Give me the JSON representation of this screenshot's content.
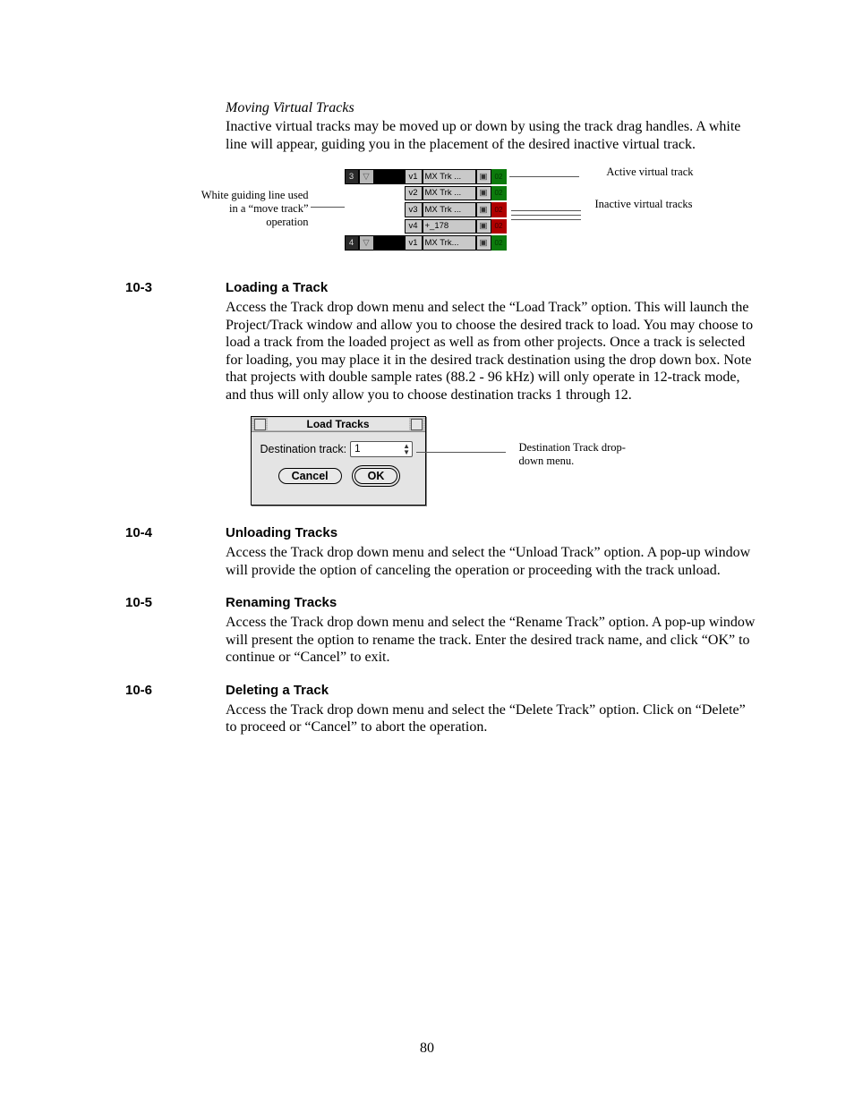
{
  "page_number": "80",
  "sec0": {
    "title": "Moving Virtual Tracks",
    "body": "Inactive virtual tracks may be moved up or down by using the track drag handles. A white line will appear, guiding you in the placement of the desired inactive virtual track."
  },
  "fig1": {
    "note_left": "White guiding line used in a “move track” operation",
    "note_right_active": "Active virtual track",
    "note_right_inactive": "Inactive virtual tracks",
    "rows": [
      {
        "num": "3",
        "v": "v1",
        "name": "MX Trk ...",
        "end": "green"
      },
      {
        "num": "",
        "v": "v2",
        "name": "MX Trk ...",
        "end": "green"
      },
      {
        "num": "",
        "v": "v3",
        "name": "MX Trk ...",
        "end": "red"
      },
      {
        "num": "",
        "v": "v4",
        "name": "+_178",
        "end": "red"
      },
      {
        "num": "4",
        "v": "v1",
        "name": "MX Trk...",
        "end": "green"
      }
    ],
    "end_badge": "02"
  },
  "sec3": {
    "num": "10-3",
    "title": "Loading a Track",
    "body": "Access the Track drop down menu and select the “Load Track” option. This will launch the Project/Track window and allow you to choose the desired track to load. You may choose to load a track from the loaded project as well as from other projects. Once a track is selected for loading, you may place it in the desired track destination using the drop down box. Note that projects with double sample rates (88.2 - 96 kHz) will only operate in 12-track mode, and thus will only allow you to choose destination tracks 1 through 12."
  },
  "fig2": {
    "dialog_title": "Load Tracks",
    "field_label": "Destination track:",
    "field_value": "1",
    "cancel": "Cancel",
    "ok": "OK",
    "note": "Destination Track drop-down menu."
  },
  "sec4": {
    "num": "10-4",
    "title": "Unloading Tracks",
    "body": "Access the Track drop down menu and select the “Unload Track” option. A pop-up window will provide the option of canceling the operation or proceeding with the track unload."
  },
  "sec5": {
    "num": "10-5",
    "title": "Renaming Tracks",
    "body": "Access the Track drop down menu and select the “Rename Track” option. A pop-up window will present the option to rename the track.  Enter the desired track name, and click “OK” to continue or “Cancel” to exit."
  },
  "sec6": {
    "num": "10-6",
    "title": "Deleting a Track",
    "body": "Access the Track drop down menu and select the “Delete Track” option. Click on “Delete” to proceed or “Cancel” to abort the operation."
  }
}
